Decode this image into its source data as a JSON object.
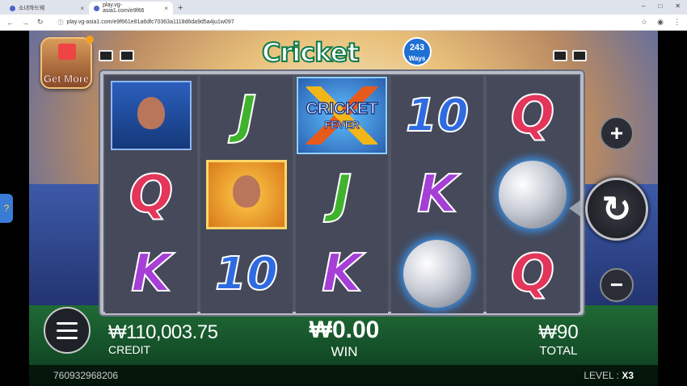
{
  "browser": {
    "tabs": [
      {
        "title": "소녀하드웨"
      },
      {
        "title": "play.vg-asia1.com/e9f66"
      }
    ],
    "new_tab": "+",
    "url": "play.vg-asia1.com/e9f661e81a6dfc70363a1118d6da9d5a4ju1w097",
    "window_controls": [
      "–",
      "□",
      "✕"
    ]
  },
  "game": {
    "title": "Cricket Fever",
    "ways_number": "243",
    "ways_label": "Ways",
    "get_more": "Get More",
    "wild_line1": "CRICKET",
    "wild_line2": "FEVER",
    "reels": [
      [
        "player-blue",
        "Q",
        "K"
      ],
      [
        "J",
        "player-gold",
        "10"
      ],
      [
        "wild",
        "J",
        "K"
      ],
      [
        "10",
        "K",
        "ball"
      ],
      [
        "Q",
        "ball",
        "Q"
      ]
    ],
    "credit_value": "₩110,003.75",
    "credit_label": "CREDIT",
    "win_value": "₩0.00",
    "win_label": "WIN",
    "total_value": "₩90",
    "total_label": "TOTAL",
    "session_id": "760932968206",
    "level_label": "LEVEL :",
    "level_value": "X3",
    "plus_label": "+",
    "minus_label": "−",
    "spin_label": "↻"
  }
}
